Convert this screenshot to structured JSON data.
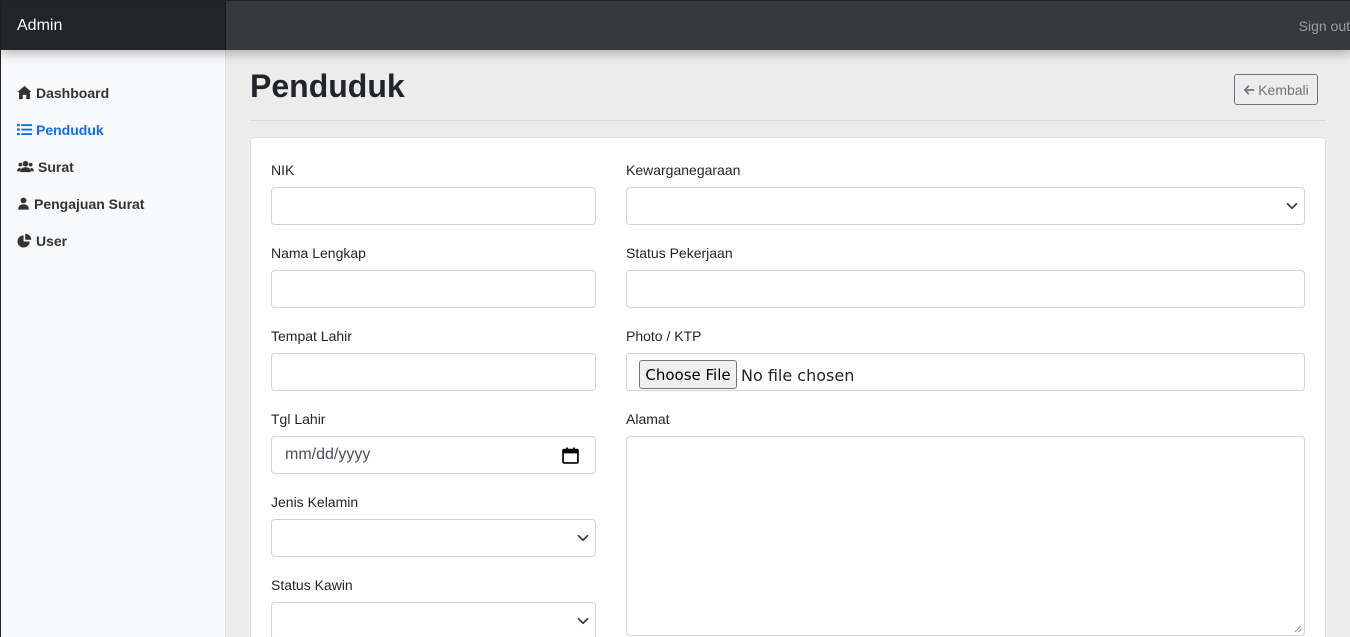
{
  "navbar": {
    "brand": "Admin",
    "signout": "Sign out"
  },
  "sidebar": {
    "items": [
      {
        "label": "Dashboard",
        "icon": "home-icon",
        "active": false
      },
      {
        "label": "Penduduk",
        "icon": "list-icon",
        "active": true
      },
      {
        "label": "Surat",
        "icon": "users-icon",
        "active": false
      },
      {
        "label": "Pengajuan Surat",
        "icon": "user-icon",
        "active": false
      },
      {
        "label": "User",
        "icon": "pie-chart-icon",
        "active": false
      }
    ]
  },
  "page": {
    "title": "Penduduk",
    "back_label": "Kembali"
  },
  "form": {
    "nik": {
      "label": "NIK",
      "value": ""
    },
    "nama": {
      "label": "Nama Lengkap",
      "value": ""
    },
    "tempat_lahir": {
      "label": "Tempat Lahir",
      "value": ""
    },
    "tgl_lahir": {
      "label": "Tgl Lahir",
      "placeholder": "mm/dd/yyyy"
    },
    "jenis_kelamin": {
      "label": "Jenis Kelamin",
      "selected": ""
    },
    "status_kawin": {
      "label": "Status Kawin",
      "selected": ""
    },
    "kewarganegaraan": {
      "label": "Kewarganegaraan",
      "selected": ""
    },
    "status_pekerjaan": {
      "label": "Status Pekerjaan",
      "value": ""
    },
    "photo": {
      "label": "Photo / KTP",
      "button": "Choose File",
      "status": "No file chosen"
    },
    "alamat": {
      "label": "Alamat",
      "value": ""
    }
  },
  "colors": {
    "accent": "#0d6efd",
    "navbar": "#343a40",
    "brand_bg": "#212529"
  }
}
